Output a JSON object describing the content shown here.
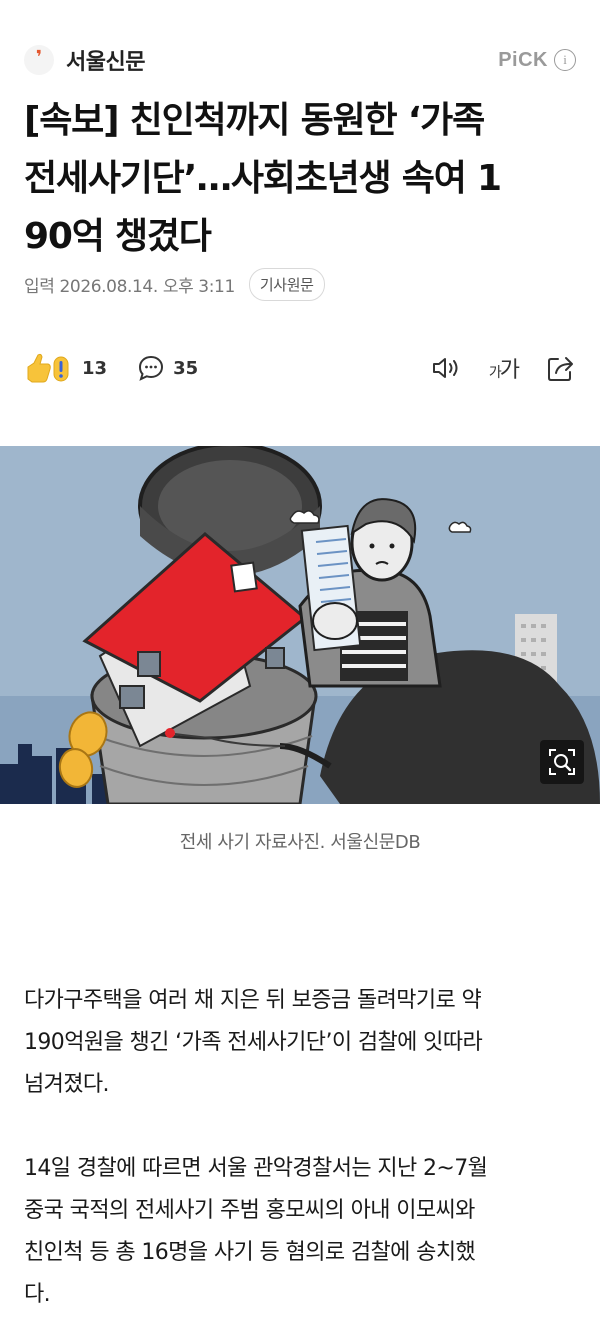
{
  "header": {
    "press_logo": "❜",
    "press_name": "서울신문",
    "pick_label": "PiCK",
    "info_glyph": "i"
  },
  "article": {
    "title_line1": "[속보] 친인척까지 동원한 ‘가족",
    "title_line2": "전세사기단’…사회초년생 속여 1",
    "title_line3": "90억 챙겼다",
    "date": "입력 2026.08.14. 오후 3:11",
    "origin_button": "기사원문"
  },
  "actions": {
    "reaction_count": "13",
    "comment_count": "35",
    "font_size_small": "가",
    "font_size_large": "가",
    "icons": [
      "reaction-icon",
      "comment-icon",
      "speaker-icon",
      "font-size-icon",
      "share-icon"
    ]
  },
  "photo": {
    "caption": "전세 사기 자료사진. 서울신문DB",
    "zoom_icon": "zoom-icon"
  },
  "body": {
    "paragraph1_line1": "다가구주택을 여러 채 지은 뒤 보증금 돌려막기로 약",
    "paragraph1_line2": "190억원을 챙긴 ‘가족 전세사기단’이 검찰에 잇따라",
    "paragraph1_line3": "넘겨졌다.",
    "paragraph2_line1": "14일 경찰에 따르면 서울 관악경찰서는 지난 2~7월",
    "paragraph2_line2": "중국 국적의 전세사기 주범 홍모씨의 아내 이모씨와",
    "paragraph2_line3": "친인척 등 총 16명을 사기 등 혐의로 검찰에 송치했",
    "paragraph2_line4": "다."
  },
  "colors": {
    "brand_orange": "#e4572e",
    "roof_red": "#e3242b",
    "sky_blue": "#9fb6cc"
  }
}
